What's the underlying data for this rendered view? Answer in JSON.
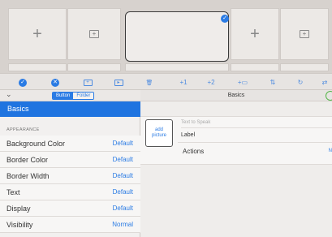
{
  "board": {
    "cells": [
      {
        "icon": "plus-icon",
        "glyph": "+"
      },
      {
        "icon": "add-folder-icon",
        "glyph": "+"
      },
      {
        "icon": "selected-button",
        "glyph": ""
      },
      {
        "icon": "plus-icon",
        "glyph": "+"
      },
      {
        "icon": "add-folder-icon",
        "glyph": "+"
      }
    ],
    "selected_badge": "✓"
  },
  "toolbar": {
    "items": [
      {
        "name": "select-all-icon",
        "glyph": "✓"
      },
      {
        "name": "deselect-icon",
        "glyph": "✕"
      },
      {
        "name": "add-button-icon",
        "glyph": "+"
      },
      {
        "name": "move-icon",
        "glyph": "▸"
      },
      {
        "name": "trash-icon",
        "glyph": "🗑"
      },
      {
        "name": "plus-one-icon",
        "glyph": "+1"
      },
      {
        "name": "plus-two-icon",
        "glyph": "+2"
      },
      {
        "name": "add-folder-toolbar-icon",
        "glyph": "+▭"
      },
      {
        "name": "sort-icon",
        "glyph": "⇅"
      },
      {
        "name": "refresh-icon",
        "glyph": "↻"
      },
      {
        "name": "swap-icon",
        "glyph": "⇄"
      }
    ]
  },
  "left_panel": {
    "collapse_glyph": "⌄",
    "segment": {
      "button": "Button",
      "folder": "Folder"
    },
    "selected_section": "Basics",
    "appearance_header": "APPEARANCE",
    "properties": [
      {
        "name": "Background Color",
        "value": "Default"
      },
      {
        "name": "Border Color",
        "value": "Default"
      },
      {
        "name": "Border Width",
        "value": "Default"
      },
      {
        "name": "Text",
        "value": "Default"
      },
      {
        "name": "Display",
        "value": "Default"
      },
      {
        "name": "Visibility",
        "value": "Normal"
      }
    ]
  },
  "right_panel": {
    "title": "Basics",
    "add_picture": "add\npicture",
    "tts_placeholder": "Text to Speak",
    "label": "Label",
    "actions_label": "Actions",
    "actions_value": "N"
  },
  "colors": {
    "accent": "#2a7be4",
    "selected_row": "#1f74e0",
    "green": "#56b64a"
  }
}
